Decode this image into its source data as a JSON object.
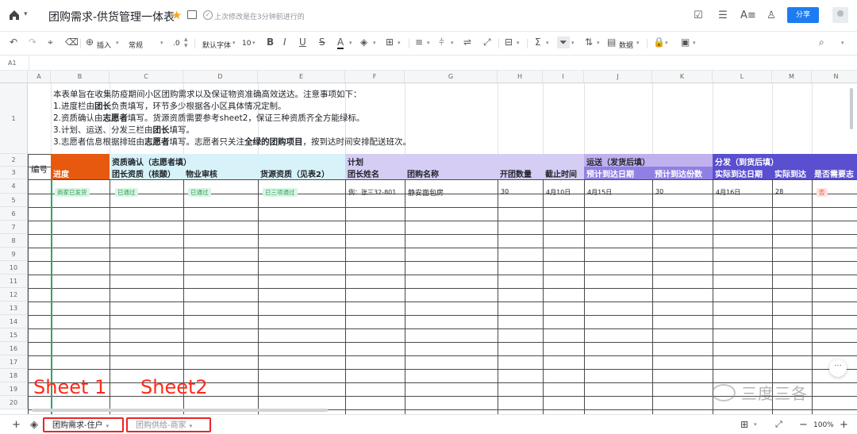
{
  "app": {
    "doc_title": "团购需求-供货管理一体表",
    "saved_status": "上次修改是在3分钟前进行的",
    "share_label": "分享"
  },
  "toolbar": {
    "insert_label": "插入",
    "format_label": "常规",
    "decimal_label": ".0",
    "font_label": "默认字体",
    "font_size": "10",
    "data_label": "数据"
  },
  "formula_bar": {
    "cell_ref": "A1"
  },
  "columns": [
    "A",
    "B",
    "C",
    "D",
    "E",
    "F",
    "G",
    "H",
    "I",
    "J",
    "K",
    "L",
    "M",
    "N"
  ],
  "rows": [
    "1",
    "2",
    "3",
    "4",
    "5",
    "6",
    "7",
    "8",
    "9",
    "10",
    "11",
    "12",
    "13",
    "14",
    "15",
    "16",
    "17",
    "18",
    "19",
    "20"
  ],
  "notes": {
    "line1": "本表单旨在收集防疫期间小区团购需求以及保证物资准确高效送达。注意事项如下：",
    "line2_a": "1.进度栏由",
    "line2_b": "团长",
    "line2_c": "负责填写，环节多少根据各小区具体情况定制。",
    "line3_a": "2.资质确认由",
    "line3_b": "志愿者",
    "line3_c": "填写。货源资质需要参考sheet2，保证三种资质齐全方能绿标。",
    "line4_a": "3.计划、运送、分发三栏由",
    "line4_b": "团长",
    "line4_c": "填写。",
    "line5_a": "3.志愿者信息根据排班由",
    "line5_b": "志愿者",
    "line5_c": "填写。志愿者只关注",
    "line5_d": "全绿的团购项目",
    "line5_e": "，按到达时间安排配送班次。"
  },
  "table": {
    "id_header": "编号",
    "progress_header": "进度",
    "qual_group": "资质确认（志愿者填）",
    "plan_group": "计划",
    "ship_group": "运送（发货后填）",
    "dist_group": "分发（到货后填）",
    "headers": {
      "c": "团长资质（核酸）",
      "d": "物业审核",
      "e": "货源资质（见表2）",
      "f": "团长姓名",
      "g": "团购名称",
      "h": "开团数量",
      "i": "截止时间",
      "j": "预计到达日期",
      "k": "预计到达份数",
      "l": "实际到达日期",
      "m": "实际到达",
      "n": "是否需要志"
    },
    "row4": {
      "b": "商家已发货",
      "c": "已通过",
      "d": "已通过",
      "e": "已三项通过",
      "f": "例：张三32-801",
      "g": "静安面包房",
      "h": "30",
      "i": "4月10日",
      "j": "4月15日",
      "k": "30",
      "l": "4月16日",
      "m": "28",
      "n": "否"
    },
    "colors": {
      "progress": "#e6590f",
      "qual": "#d7f3f9",
      "plan": "#d6cdf5",
      "ship_group": "#c0b1ee",
      "ship_header": "#9180e3",
      "dist": "#5a4fcf"
    }
  },
  "sheets": {
    "tab1": "团购需求-住户",
    "tab2": "团购供给-商家",
    "annot1": "Sheet 1",
    "annot2": "Sheet2"
  },
  "zoom": "100%",
  "watermark": "三度三各"
}
